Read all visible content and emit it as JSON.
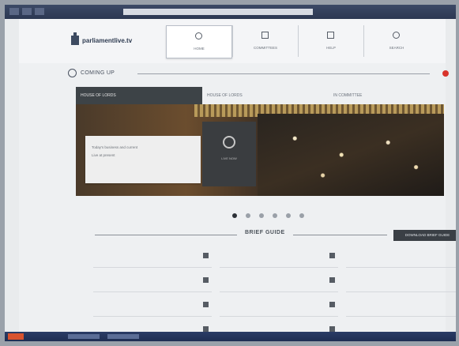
{
  "site": {
    "logo_text": "parliamentlive.tv"
  },
  "nav": [
    {
      "label": "HOME",
      "icon": "home-icon"
    },
    {
      "label": "COMMITTEES",
      "icon": "committees-icon"
    },
    {
      "label": "HELP",
      "icon": "help-icon"
    },
    {
      "label": "SEARCH",
      "icon": "search-icon"
    }
  ],
  "coming_up": {
    "title": "COMING UP"
  },
  "tabs": [
    {
      "label": "HOUSE OF LORDS"
    },
    {
      "label": "HOUSE OF LORDS"
    },
    {
      "label": "IN COMMITTEE"
    }
  ],
  "hero": {
    "card_line1": "Today's business and current",
    "card_line2": "Live at present",
    "play_label": "LIVE NOW"
  },
  "carousel": {
    "slide_count": 6,
    "active_index": 0
  },
  "brief_guide": {
    "title": "BRIEF GUIDE",
    "download_label": "DOWNLOAD BRIEF GUIDE"
  },
  "colors": {
    "accent_red": "#d8332b",
    "dark_tab": "#3d4347"
  }
}
